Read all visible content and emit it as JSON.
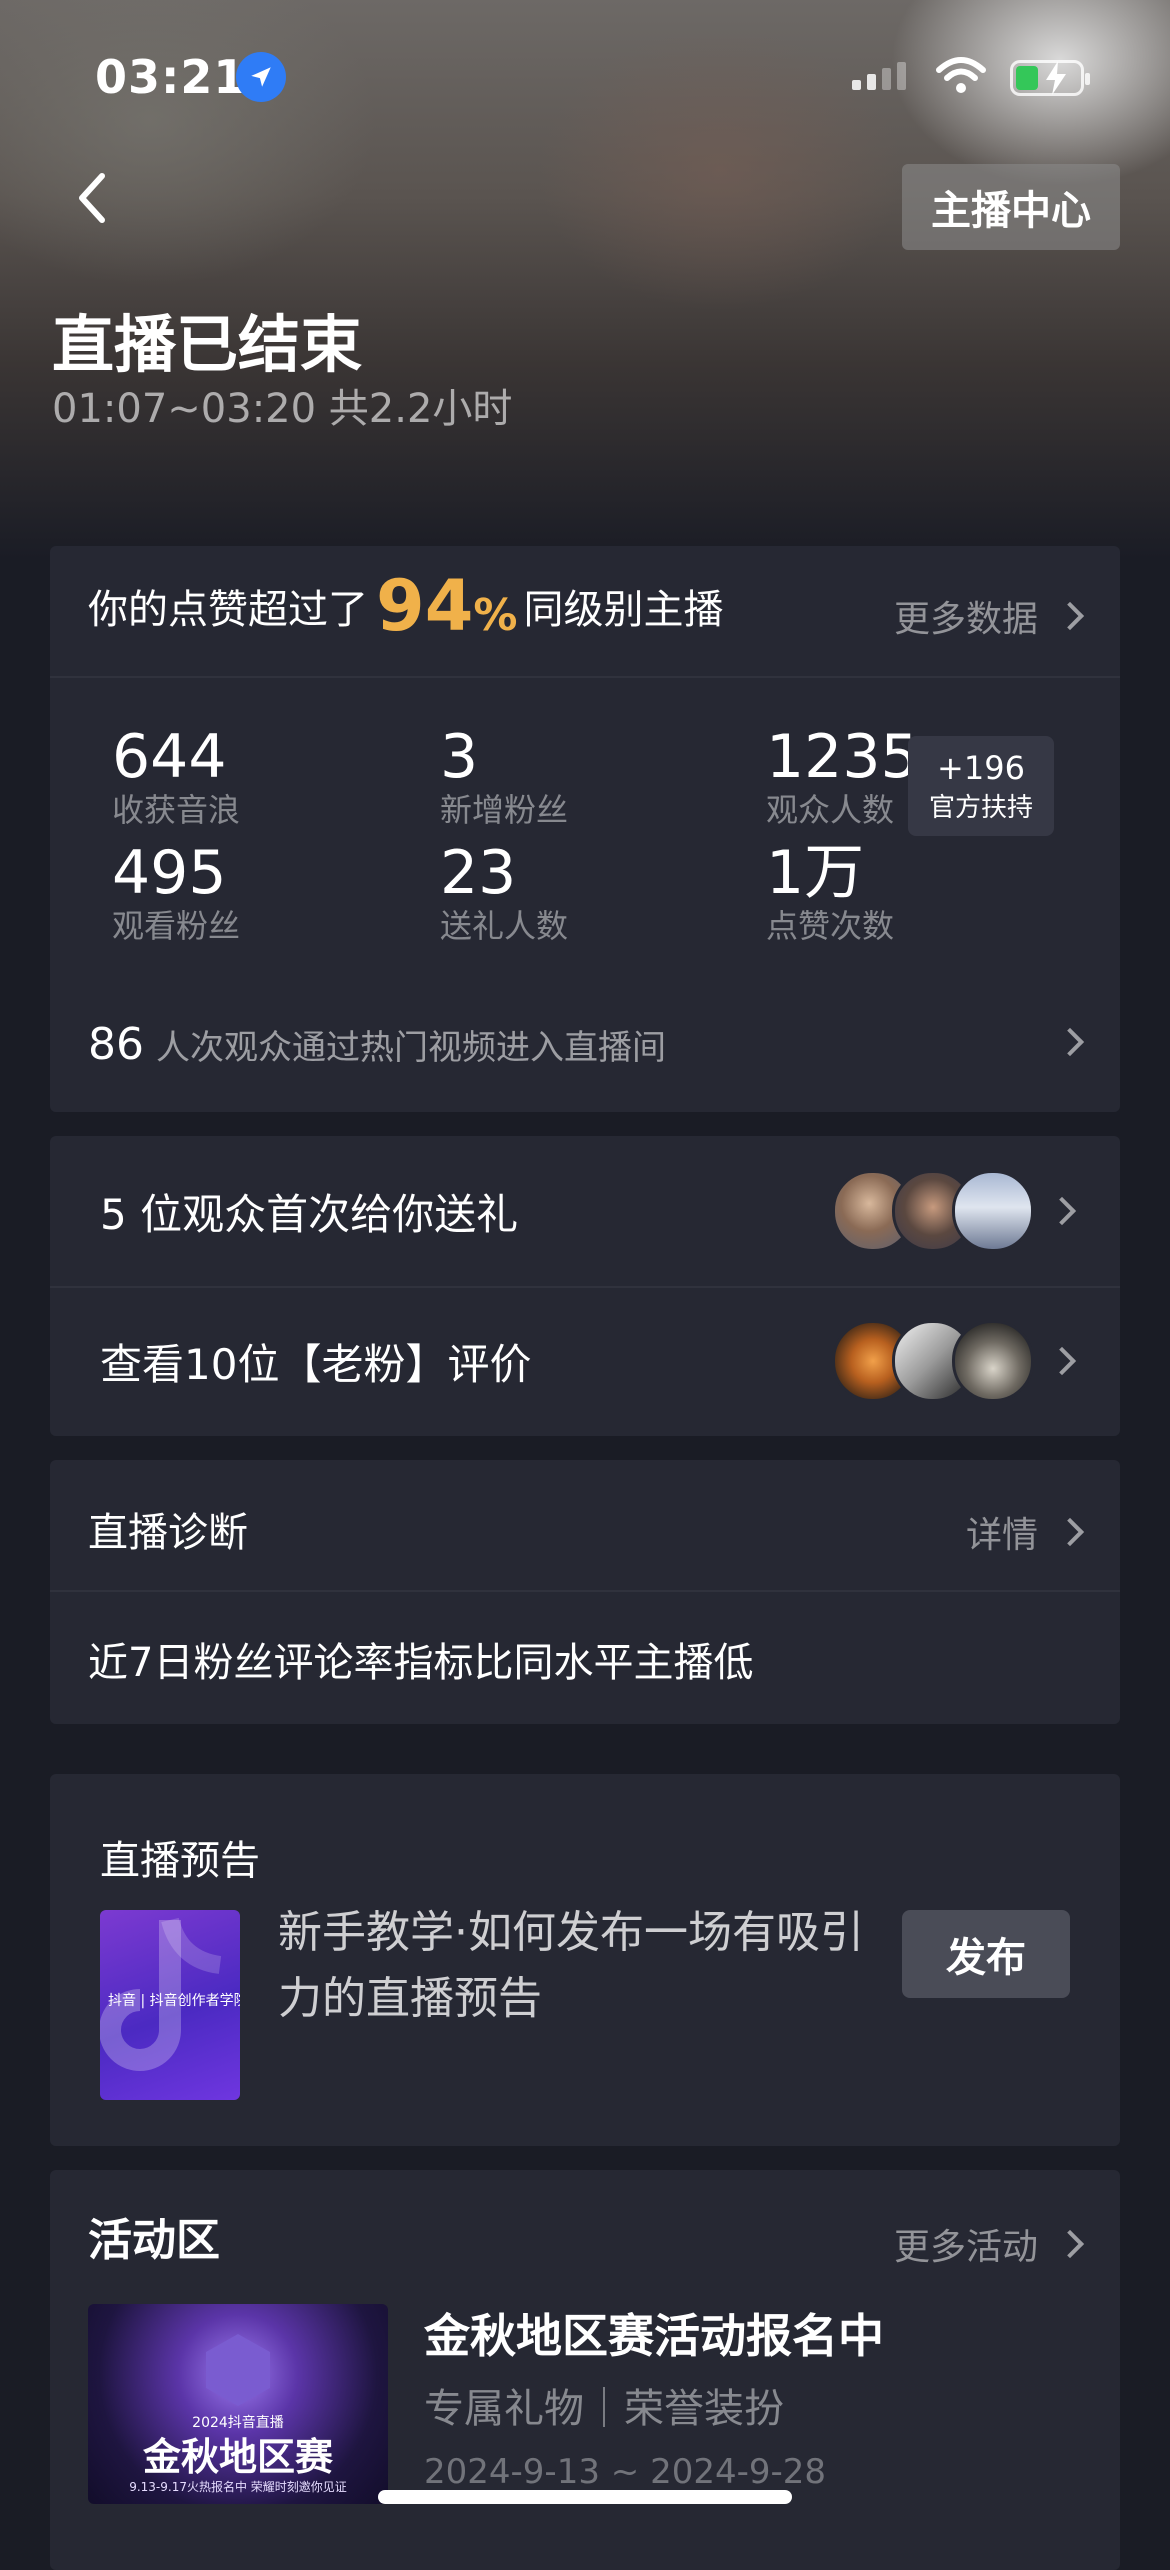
{
  "status_bar": {
    "time": "03:21"
  },
  "header": {
    "anchor_center_label": "主播中心",
    "title": "直播已结束",
    "time_range": "01:07~03:20 共2.2小时"
  },
  "summary": {
    "likes_prefix": "你的点赞超过了",
    "likes_percent": "94",
    "percent_sign": "%",
    "likes_suffix": "同级别主播",
    "more_data": "更多数据",
    "stats": [
      {
        "value": "644",
        "label": "收获音浪"
      },
      {
        "value": "3",
        "label": "新增粉丝"
      },
      {
        "value": "1235",
        "label": "观众人数"
      },
      {
        "value": "495",
        "label": "观看粉丝"
      },
      {
        "value": "23",
        "label": "送礼人数"
      },
      {
        "value": "1万",
        "label": "点赞次数"
      }
    ],
    "boost": {
      "value": "+196",
      "label": "官方扶持"
    },
    "hot_count": "86",
    "hot_text": "人次观众通过热门视频进入直播间"
  },
  "social": {
    "gift_row": "5 位观众首次给你送礼",
    "review_row": "查看10位【老粉】评价"
  },
  "diagnosis": {
    "title": "直播诊断",
    "detail": "详情",
    "message": "近7日粉丝评论率指标比同水平主播低"
  },
  "preview": {
    "title": "直播预告",
    "thumb_caption": "抖音 | 抖音创作者学院",
    "description": "新手教学·如何发布一场有吸引力的直播预告",
    "publish": "发布"
  },
  "activity": {
    "title": "活动区",
    "more": "更多活动",
    "banner_year": "2024抖音直播",
    "banner_big": "金秋地区赛",
    "banner_small": "9.13-9.17火热报名中 荣耀时刻邀你见证",
    "name": "金秋地区赛活动报名中",
    "tags": "专属礼物｜荣誉装扮",
    "date": "2024-9-13 ~ 2024-9-28"
  },
  "colors": {
    "accent": "#f0b14a",
    "card": "#262833",
    "background": "#1a1c25"
  }
}
